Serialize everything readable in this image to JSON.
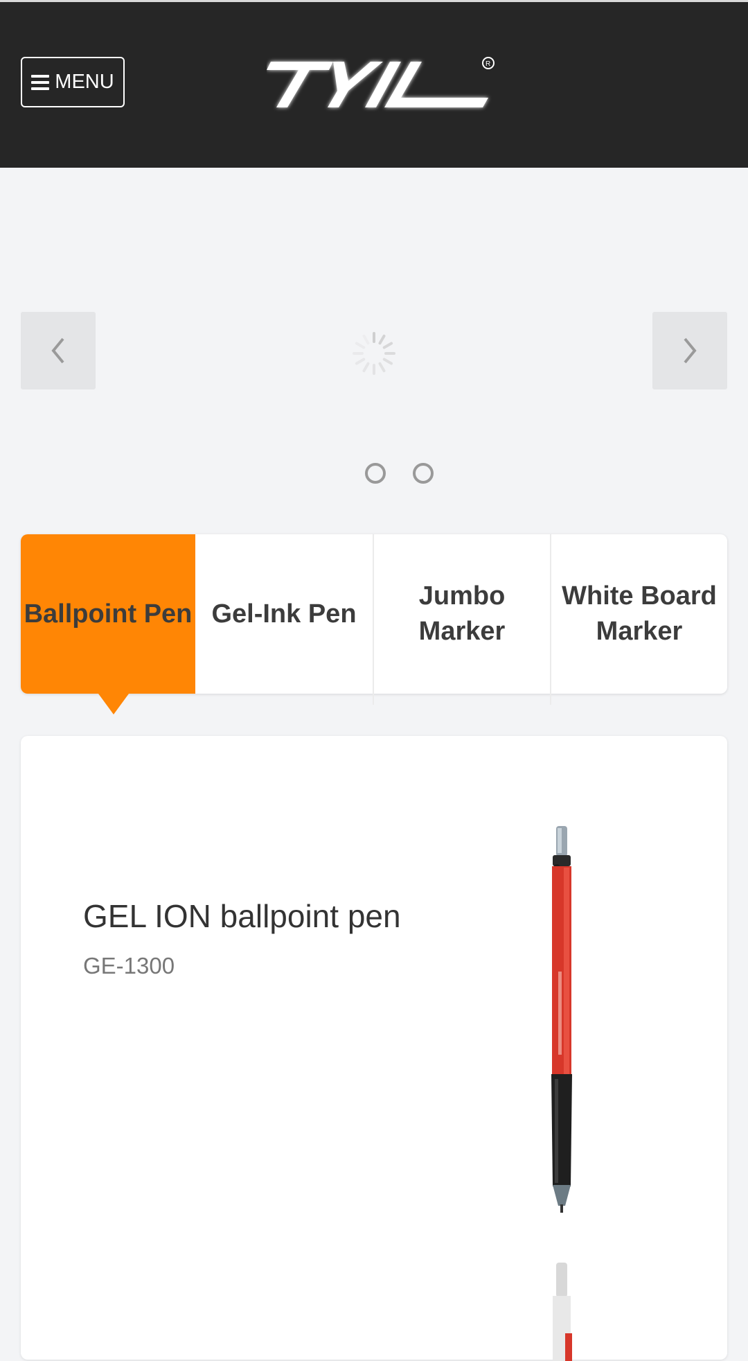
{
  "header": {
    "menu_label": "MENU",
    "brand": "TYIL"
  },
  "slider": {
    "prev_icon": "chevron-left-icon",
    "next_icon": "chevron-right-icon",
    "slide_count": 2
  },
  "tabs": [
    {
      "label": "Ballpoint Pen",
      "active": true
    },
    {
      "label": "Gel-Ink Pen",
      "active": false
    },
    {
      "label": "Jumbo Marker",
      "active": false
    },
    {
      "label": "White Board Marker",
      "active": false
    }
  ],
  "product": {
    "name": "GEL ION ballpoint pen",
    "code": "GE-1300"
  },
  "colors": {
    "header_bg": "#262626",
    "accent": "#ff8605",
    "page_bg": "#f3f4f6"
  }
}
